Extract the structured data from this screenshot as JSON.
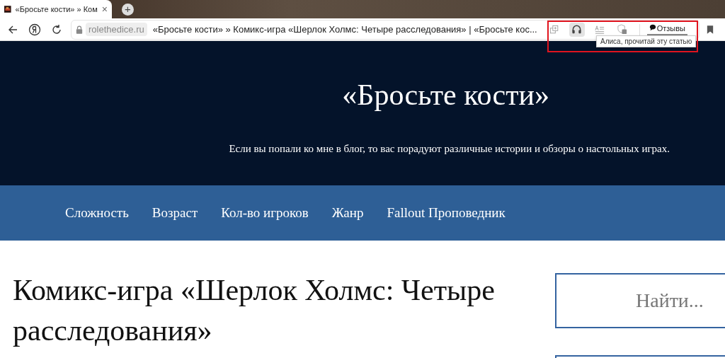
{
  "browser": {
    "tab": {
      "title": "«Бросьте кости» » Ком",
      "close": "×"
    },
    "new_tab": "+",
    "address": {
      "domain": "rolethedice.ru",
      "page_title": "«Бросьте кости» » Комикс-игра «Шерлок Холмс: Четыре расследования» | «Бросьте кос..."
    },
    "toolbar_buttons": [
      {
        "kind": "copy",
        "active": false
      },
      {
        "kind": "headphones",
        "active": true
      },
      {
        "kind": "reader",
        "active": false
      },
      {
        "kind": "shield",
        "active": false
      }
    ],
    "reviews": "Отзывы",
    "tooltip": "Алиса, прочитай эту статью"
  },
  "site": {
    "title": "«Бросьте кости»",
    "tagline": "Если вы попали ко мне в блог, то вас порадуют различные истории и обзоры о настольных играх.",
    "nav": [
      "Сложность",
      "Возраст",
      "Кол-во игроков",
      "Жанр",
      "Fallout Проповедник"
    ]
  },
  "article": {
    "title": "Комикс-игра «Шерлок Холмс: Четыре расследования»"
  },
  "sidebar": {
    "search": {
      "placeholder": "Найти..."
    }
  }
}
